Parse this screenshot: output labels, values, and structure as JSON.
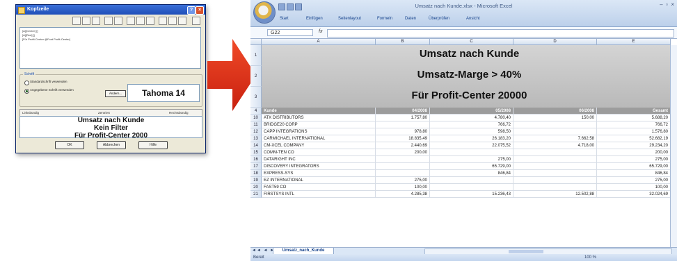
{
  "dialog": {
    "title": "Kopfzeile",
    "header_text_lines": [
      "[A][Center] []",
      "[A][Red] []",
      "[Für Profit-Center @Font Profit-Center]"
    ],
    "font_group_label": "Schrift",
    "radio_default": "Standardschrift verwenden",
    "radio_custom": "Angegebene Schrift verwenden",
    "font_button": "Ändern...",
    "font_display": "Tahoma 14",
    "tab_left": "Linksbündig",
    "tab_center": "Zentriert",
    "tab_right": "Rechtsbündig",
    "preview_lines": [
      "Umsatz nach Kunde",
      "Kein Filter",
      "Für Profit-Center 2000"
    ],
    "buttons": [
      "OK",
      "Abbrechen",
      "Hilfe"
    ]
  },
  "excel": {
    "window_title": "Umsatz nach Kunde.xlsx - Microsoft Excel",
    "ribbon_tabs": [
      "Start",
      "Einfügen",
      "Seitenlayout",
      "Formeln",
      "Daten",
      "Überprüfen",
      "Ansicht"
    ],
    "name_box": "G22",
    "fx": "fx",
    "columns": [
      "A",
      "B",
      "C",
      "D",
      "E"
    ],
    "title_lines": [
      "Umsatz nach Kunde",
      "Umsatz-Marge > 40%",
      "Für Profit-Center 20000"
    ],
    "title_row_numbers": [
      "1",
      "2",
      "3"
    ],
    "header_row": {
      "row": "4",
      "cells": [
        "Kunde",
        "04/2008",
        "05/2008",
        "06/2008",
        "Gesamt"
      ]
    },
    "rows": [
      {
        "row": "10",
        "cells": [
          "ATX DISTRIBUTORS",
          "1.757,80",
          "4.780,40",
          "150,00",
          "5.688,20"
        ]
      },
      {
        "row": "11",
        "cells": [
          "BRIDGE20 CORP",
          "",
          "766,72",
          "",
          "766,72"
        ]
      },
      {
        "row": "12",
        "cells": [
          "CAPP INTEGRATIONS",
          "978,80",
          "598,50",
          "",
          "1.576,80"
        ]
      },
      {
        "row": "13",
        "cells": [
          "CARMICHAEL INTERNATIONAL",
          "18.835,49",
          "26.183,20",
          "7.662,58",
          "52.682,19"
        ]
      },
      {
        "row": "14",
        "cells": [
          "CM-XCEL COMPANY",
          "2.440,69",
          "22.075,52",
          "4.718,00",
          "29.234,20"
        ]
      },
      {
        "row": "15",
        "cells": [
          "COMM-TEN CO",
          "200,00",
          "",
          "",
          "200,00"
        ]
      },
      {
        "row": "16",
        "cells": [
          "DATARIGHT INC",
          "",
          "275,00",
          "",
          "275,00"
        ]
      },
      {
        "row": "17",
        "cells": [
          "DISCOVERY INTEGRATORS",
          "",
          "65.729,00",
          "",
          "65.729,00"
        ]
      },
      {
        "row": "18",
        "cells": [
          "EXPRESS-SYS",
          "",
          "846,84",
          "",
          "846,84"
        ]
      },
      {
        "row": "19",
        "cells": [
          "EZ INTERNATIONAL",
          "275,00",
          "",
          "",
          "275,00"
        ]
      },
      {
        "row": "20",
        "cells": [
          "FAST59 CO",
          "100,00",
          "",
          "",
          "100,00"
        ]
      },
      {
        "row": "21",
        "cells": [
          "FIRSTSYS INTL",
          "4.285,38",
          "15.236,43",
          "12.502,88",
          "32.024,69"
        ]
      }
    ],
    "sheet_tab": "Umsatz_nach_Kunde",
    "status": "Bereit",
    "zoom": "100 %"
  }
}
